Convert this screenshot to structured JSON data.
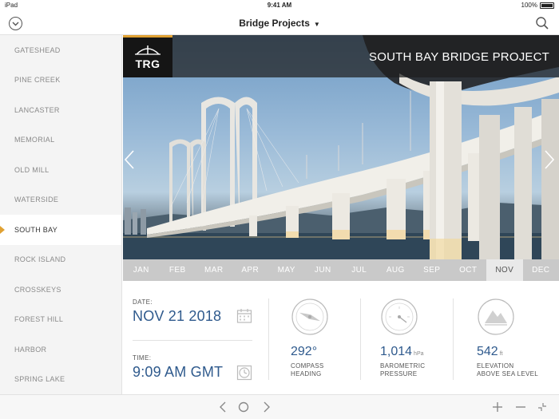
{
  "status_bar": {
    "device": "iPad",
    "time": "9:41 AM",
    "battery": "100%"
  },
  "nav": {
    "title": "Bridge Projects"
  },
  "sidebar": {
    "items": [
      {
        "label": "GATESHEAD"
      },
      {
        "label": "PINE CREEK"
      },
      {
        "label": "LANCASTER"
      },
      {
        "label": "MEMORIAL"
      },
      {
        "label": "OLD MILL"
      },
      {
        "label": "WATERSIDE"
      },
      {
        "label": "SOUTH BAY"
      },
      {
        "label": "ROCK ISLAND"
      },
      {
        "label": "CROSSKEYS"
      },
      {
        "label": "FOREST HILL"
      },
      {
        "label": "HARBOR"
      },
      {
        "label": "SPRING LAKE"
      }
    ],
    "active_index": 6
  },
  "hero": {
    "logo": "TRG",
    "title": "SOUTH BAY BRIDGE PROJECT"
  },
  "months": [
    "JAN",
    "FEB",
    "MAR",
    "APR",
    "MAY",
    "JUN",
    "JUL",
    "AUG",
    "SEP",
    "OCT",
    "NOV",
    "DEC"
  ],
  "active_month_index": 10,
  "info": {
    "date_label": "DATE:",
    "date_value": "NOV 21 2018",
    "time_label": "TIME:",
    "time_value": "9:09 AM GMT",
    "compass": {
      "value": "292°",
      "label1": "COMPASS",
      "label2": "HEADING"
    },
    "pressure": {
      "value": "1,014",
      "unit": "hPa",
      "label1": "BAROMETRIC",
      "label2": "PRESSURE"
    },
    "elevation": {
      "value": "542",
      "unit": "ft",
      "label1": "ELEVATION",
      "label2": "ABOVE SEA LEVEL"
    }
  },
  "colors": {
    "accent": "#e0a133",
    "value_blue": "#2f5a8d",
    "sidebar_bg": "#f4f4f4",
    "month_strip": "#c9c9c9"
  }
}
